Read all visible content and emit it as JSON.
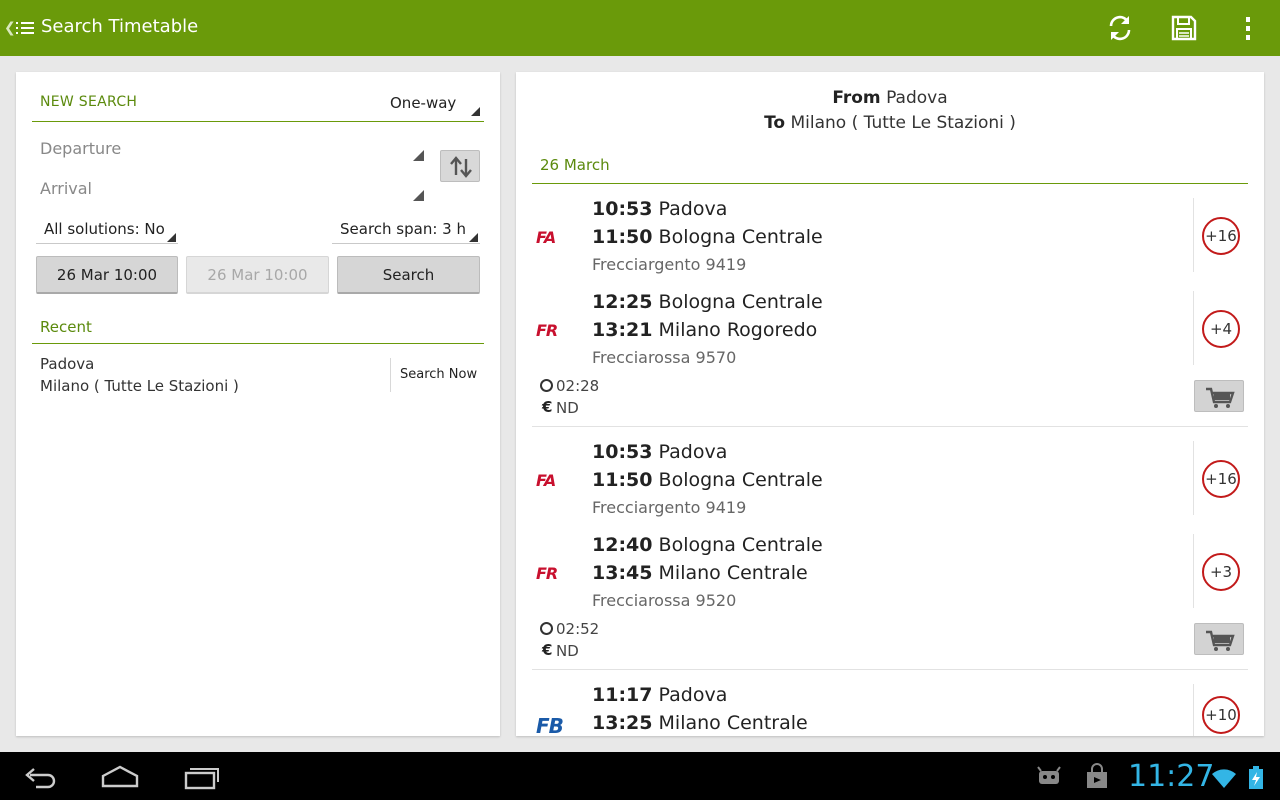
{
  "actionbar": {
    "title": "Search Timetable",
    "refresh_icon": "refresh-icon",
    "save_icon": "save-icon",
    "overflow_icon": "overflow-menu-icon",
    "bg_color": "#6a9a0a"
  },
  "search": {
    "header": "NEW SEARCH",
    "trip_type": "One-way",
    "departure_placeholder": "Departure",
    "arrival_placeholder": "Arrival",
    "all_solutions": "All solutions: No",
    "search_span": "Search span: 3 h",
    "departure_datetime": "26 Mar 10:00",
    "return_datetime": "26 Mar 10:00",
    "search_button": "Search"
  },
  "recent": {
    "header": "Recent",
    "items": [
      {
        "from": "Padova",
        "to": "Milano ( Tutte Le Stazioni )",
        "action": "Search Now"
      }
    ]
  },
  "results": {
    "from_label": "From",
    "from": "Padova",
    "to_label": "To",
    "to": "Milano ( Tutte Le Stazioni )",
    "date": "26 March",
    "solutions": [
      {
        "legs": [
          {
            "logo": "FA",
            "dep_time": "10:53",
            "dep_station": "Padova",
            "arr_time": "11:50",
            "arr_station": "Bologna Centrale",
            "train": "Frecciargento 9419",
            "stops": "+16"
          },
          {
            "logo": "FR",
            "dep_time": "12:25",
            "dep_station": "Bologna Centrale",
            "arr_time": "13:21",
            "arr_station": "Milano Rogoredo",
            "train": "Frecciarossa 9570",
            "stops": "+4"
          }
        ],
        "duration": "02:28",
        "price_symbol": "€",
        "price": "ND"
      },
      {
        "legs": [
          {
            "logo": "FA",
            "dep_time": "10:53",
            "dep_station": "Padova",
            "arr_time": "11:50",
            "arr_station": "Bologna Centrale",
            "train": "Frecciargento 9419",
            "stops": "+16"
          },
          {
            "logo": "FR",
            "dep_time": "12:40",
            "dep_station": "Bologna Centrale",
            "arr_time": "13:45",
            "arr_station": "Milano Centrale",
            "train": "Frecciarossa 9520",
            "stops": "+3"
          }
        ],
        "duration": "02:52",
        "price_symbol": "€",
        "price": "ND"
      },
      {
        "legs": [
          {
            "logo": "FB",
            "dep_time": "11:17",
            "dep_station": "Padova",
            "arr_time": "13:25",
            "arr_station": "Milano Centrale",
            "stops": "+10"
          }
        ]
      }
    ]
  },
  "system": {
    "time": "11:27",
    "accent_color": "#33b5e5"
  }
}
